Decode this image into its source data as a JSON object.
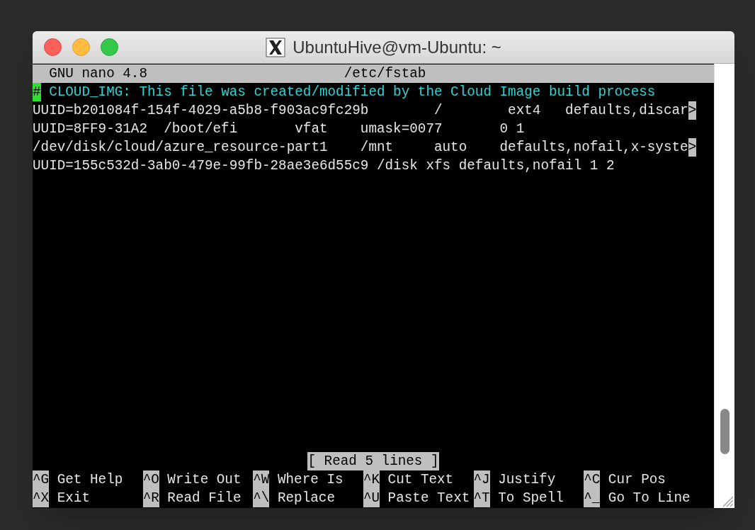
{
  "window": {
    "title": "UbuntuHive@vm-Ubuntu: ~"
  },
  "nano": {
    "app": "GNU nano 4.8",
    "filename": "/etc/fstab"
  },
  "lines": [
    {
      "kind": "comment",
      "cursor": "#",
      "text": " CLOUD_IMG: This file was created/modified by the Cloud Image build process"
    },
    {
      "kind": "plain",
      "text": "UUID=b201084f-154f-4029-a5b8-f903ac9fc29b        /        ext4   defaults,discar",
      "more": ">"
    },
    {
      "kind": "plain",
      "text": "UUID=8FF9-31A2  /boot/efi       vfat    umask=0077       0 1"
    },
    {
      "kind": "plain",
      "text": "/dev/disk/cloud/azure_resource-part1    /mnt     auto    defaults,nofail,x-syste",
      "more": ">"
    },
    {
      "kind": "plain",
      "text": "UUID=155c532d-3ab0-479e-99fb-28ae3e6d55c9 /disk xfs defaults,nofail 1 2"
    }
  ],
  "status": "[ Read 5 lines ]",
  "shortcuts": [
    [
      {
        "key": "^G",
        "label": "Get Help"
      },
      {
        "key": "^O",
        "label": "Write Out"
      },
      {
        "key": "^W",
        "label": "Where Is"
      },
      {
        "key": "^K",
        "label": "Cut Text"
      },
      {
        "key": "^J",
        "label": "Justify"
      },
      {
        "key": "^C",
        "label": "Cur Pos"
      }
    ],
    [
      {
        "key": "^X",
        "label": "Exit"
      },
      {
        "key": "^R",
        "label": "Read File"
      },
      {
        "key": "^\\",
        "label": "Replace"
      },
      {
        "key": "^U",
        "label": "Paste Text"
      },
      {
        "key": "^T",
        "label": "To Spell"
      },
      {
        "key": "^_",
        "label": "Go To Line"
      }
    ]
  ]
}
